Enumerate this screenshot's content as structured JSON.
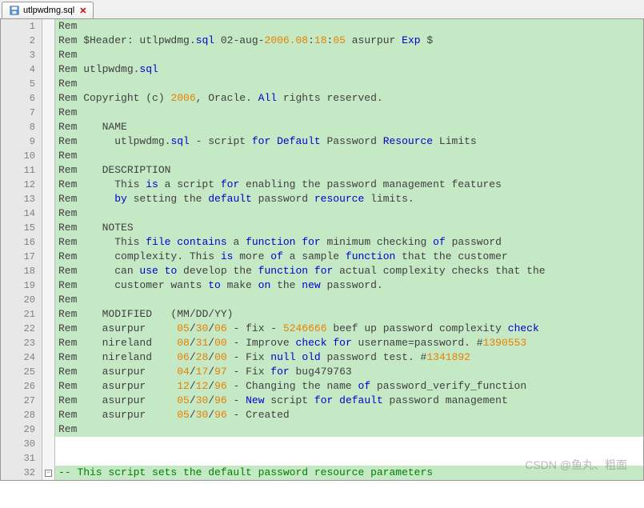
{
  "tab": {
    "filename": "utlpwdmg.sql"
  },
  "watermark": "CSDN @鱼丸、粗面",
  "lines": {
    "l1": "Rem",
    "l2a": "Rem $Header: utlpwdmg.",
    "l2b": "sql",
    "l2c": " 02-aug-",
    "l2d": "2006.08",
    "l2e": ":",
    "l2f": "18",
    "l2g": ":",
    "l2h": "05",
    "l2i": " asurpur ",
    "l2j": "Exp",
    "l2k": " $",
    "l3": "Rem",
    "l4a": "Rem utlpwdmg.",
    "l4b": "sql",
    "l5": "Rem",
    "l6a": "Rem Copyright (c) ",
    "l6b": "2006",
    "l6c": ", Oracle. ",
    "l6d": "All",
    "l6e": " rights reserved.",
    "l7": "Rem",
    "l8": "Rem    NAME",
    "l9a": "Rem      utlpwdmg.",
    "l9b": "sql",
    "l9c": " - script ",
    "l9d": "for",
    "l9e": " ",
    "l9f": "Default",
    "l9g": " Password ",
    "l9h": "Resource",
    "l9i": " Limits",
    "l10": "Rem",
    "l11": "Rem    DESCRIPTION",
    "l12a": "Rem      This ",
    "l12b": "is",
    "l12c": " a script ",
    "l12d": "for",
    "l12e": " enabling the password management features",
    "l13a": "Rem      ",
    "l13b": "by",
    "l13c": " setting the ",
    "l13d": "default",
    "l13e": " password ",
    "l13f": "resource",
    "l13g": " limits.",
    "l14": "Rem",
    "l15": "Rem    NOTES",
    "l16a": "Rem      This ",
    "l16b": "file",
    "l16c": " ",
    "l16d": "contains",
    "l16e": " a ",
    "l16f": "function",
    "l16g": " ",
    "l16h": "for",
    "l16i": " minimum checking ",
    "l16j": "of",
    "l16k": " password",
    "l17a": "Rem      complexity. This ",
    "l17b": "is",
    "l17c": " more ",
    "l17d": "of",
    "l17e": " a sample ",
    "l17f": "function",
    "l17g": " that the customer",
    "l18a": "Rem      can ",
    "l18b": "use",
    "l18c": " ",
    "l18d": "to",
    "l18e": " develop the ",
    "l18f": "function",
    "l18g": " ",
    "l18h": "for",
    "l18i": " actual complexity checks that the",
    "l19a": "Rem      customer wants ",
    "l19b": "to",
    "l19c": " make ",
    "l19d": "on",
    "l19e": " the ",
    "l19f": "new",
    "l19g": " password.",
    "l20": "Rem",
    "l21a": "Rem    MODIFIED   (MM",
    "l21b": "/",
    "l21c": "DD",
    "l21d": "/",
    "l21e": "YY)",
    "l22a": "Rem    asurpur     ",
    "l22b": "05",
    "l22c": "/",
    "l22d": "30",
    "l22e": "/",
    "l22f": "06",
    "l22g": " - fix - ",
    "l22h": "5246666",
    "l22i": " beef up password complexity ",
    "l22j": "check",
    "l23a": "Rem    nireland    ",
    "l23b": "08",
    "l23c": "/",
    "l23d": "31",
    "l23e": "/",
    "l23f": "00",
    "l23g": " - Improve ",
    "l23h": "check",
    "l23i": " ",
    "l23j": "for",
    "l23k": " username=password. #",
    "l23l": "1390553",
    "l24a": "Rem    nireland    ",
    "l24b": "06",
    "l24c": "/",
    "l24d": "28",
    "l24e": "/",
    "l24f": "00",
    "l24g": " - Fix ",
    "l24h": "null",
    "l24i": " ",
    "l24j": "old",
    "l24k": " password test. #",
    "l24l": "1341892",
    "l25a": "Rem    asurpur     ",
    "l25b": "04",
    "l25c": "/",
    "l25d": "17",
    "l25e": "/",
    "l25f": "97",
    "l25g": " - Fix ",
    "l25h": "for",
    "l25i": " bug479763",
    "l26a": "Rem    asurpur     ",
    "l26b": "12",
    "l26c": "/",
    "l26d": "12",
    "l26e": "/",
    "l26f": "96",
    "l26g": " - Changing the name ",
    "l26h": "of",
    "l26i": " password_verify_function",
    "l27a": "Rem    asurpur     ",
    "l27b": "05",
    "l27c": "/",
    "l27d": "30",
    "l27e": "/",
    "l27f": "96",
    "l27g": " - ",
    "l27h": "New",
    "l27i": " script ",
    "l27j": "for",
    "l27k": " ",
    "l27l": "default",
    "l27m": " password management",
    "l28a": "Rem    asurpur     ",
    "l28b": "05",
    "l28c": "/",
    "l28d": "30",
    "l28e": "/",
    "l28f": "96",
    "l28g": " - Created",
    "l29": "Rem",
    "l30": " ",
    "l31": " ",
    "l32": "-- This script sets the default password resource parameters"
  }
}
